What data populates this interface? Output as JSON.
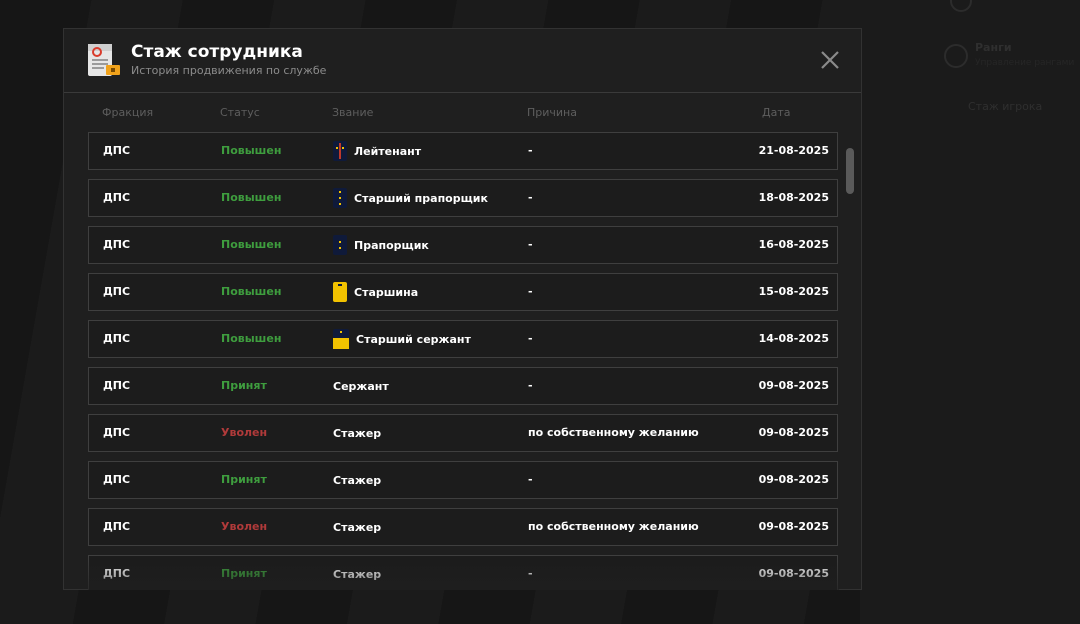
{
  "modal": {
    "title": "Стаж сотрудника",
    "subtitle": "История продвижения по службе"
  },
  "columns": {
    "faction": "Фракция",
    "status": "Статус",
    "rank": "Звание",
    "reason": "Причина",
    "date": "Дата"
  },
  "rows": [
    {
      "faction": "ДПС",
      "status": "Повышен",
      "status_type": "promoted",
      "rank": "Лейтенант",
      "rank_icon": "lieutenant-shoulder-board-icon",
      "reason": "-",
      "date": "21-08-2025"
    },
    {
      "faction": "ДПС",
      "status": "Повышен",
      "status_type": "promoted",
      "rank": "Старший прапорщик",
      "rank_icon": "senior-warrant-officer-shoulder-board-icon",
      "reason": "-",
      "date": "18-08-2025"
    },
    {
      "faction": "ДПС",
      "status": "Повышен",
      "status_type": "promoted",
      "rank": "Прапорщик",
      "rank_icon": "warrant-officer-shoulder-board-icon",
      "reason": "-",
      "date": "16-08-2025"
    },
    {
      "faction": "ДПС",
      "status": "Повышен",
      "status_type": "promoted",
      "rank": "Старшина",
      "rank_icon": "sergeant-major-shoulder-board-icon",
      "reason": "-",
      "date": "15-08-2025"
    },
    {
      "faction": "ДПС",
      "status": "Повышен",
      "status_type": "promoted",
      "rank": "Старший сержант",
      "rank_icon": "senior-sergeant-shoulder-board-icon",
      "reason": "-",
      "date": "14-08-2025"
    },
    {
      "faction": "ДПС",
      "status": "Принят",
      "status_type": "accepted",
      "rank": "Сержант",
      "rank_icon": "",
      "reason": "-",
      "date": "09-08-2025"
    },
    {
      "faction": "ДПС",
      "status": "Уволен",
      "status_type": "fired",
      "rank": "Стажер",
      "rank_icon": "",
      "reason": "по собственному желанию",
      "date": "09-08-2025"
    },
    {
      "faction": "ДПС",
      "status": "Принят",
      "status_type": "accepted",
      "rank": "Стажер",
      "rank_icon": "",
      "reason": "-",
      "date": "09-08-2025"
    },
    {
      "faction": "ДПС",
      "status": "Уволен",
      "status_type": "fired",
      "rank": "Стажер",
      "rank_icon": "",
      "reason": "по собственному желанию",
      "date": "09-08-2025"
    },
    {
      "faction": "ДПС",
      "status": "Принят",
      "status_type": "accepted",
      "rank": "Стажер",
      "rank_icon": "",
      "reason": "-",
      "date": "09-08-2025"
    }
  ],
  "background": {
    "side_title": "Ранги",
    "side_subtitle": "Управление рангами",
    "side_link": "Стаж игрока"
  },
  "colors": {
    "promoted": "#3e9d3e",
    "accepted": "#3e9d3e",
    "fired": "#b03a3a",
    "badge_navy": "#0f1a3a",
    "badge_gold": "#f2c200"
  }
}
